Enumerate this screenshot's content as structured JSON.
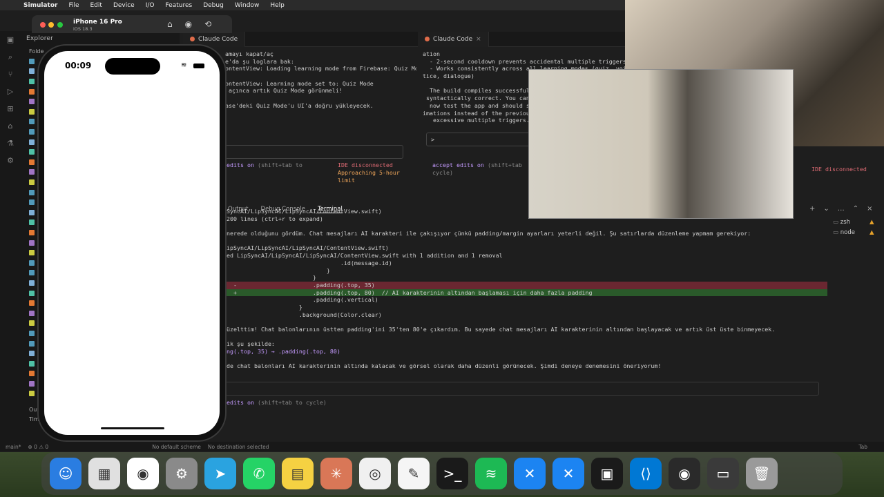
{
  "menubar": {
    "app": "Simulator",
    "items": [
      "File",
      "Edit",
      "Device",
      "I/O",
      "Features",
      "Debug",
      "Window",
      "Help"
    ]
  },
  "simulator": {
    "device": "iPhone 16 Pro",
    "os": "iOS 18.3",
    "time": "00:09"
  },
  "explorer": {
    "title": "Explorer",
    "folder_label": "Folde",
    "outline_label": "Out",
    "timeline_label": "Timel"
  },
  "editor_left": {
    "tab": "Claude Code",
    "lines": [
      "amayı kapat/aç",
      "e'da şu loglara bak:",
      "ontentView: Loading learning mode from Firebase: Quiz Mo",
      "",
      "ontentView: Learning mode set to: Quiz Mode",
      " açınca artık Quiz Mode görünmeli!",
      "",
      "ase'deki Quiz Mode'u UI'a doğru yükleyecek."
    ],
    "edits_on": "edits on",
    "edits_hint": "(shift+tab to",
    "ide_status": "IDE disconnected",
    "limit_1": "Approaching 5-hour",
    "limit_2": "limit"
  },
  "editor_right": {
    "tab": "Claude Code",
    "lines": [
      "ation",
      "  - 2-second cooldown prevents accidental multiple triggers",
      "  - Works consistently across all learning modes (quiz, voice",
      "tice, dialogue)",
      "",
      "  The build compiles successful",
      " syntactically correct. You can",
      "  now test the app and should se",
      "imations instead of the previou",
      "   excessive multiple triggers."
    ],
    "prompt": ">",
    "accept_edits": "accept edits on",
    "accept_hint_1": "(shift+tab",
    "accept_hint_2": "cycle)",
    "ide_status": "IDE disconnected"
  },
  "panel": {
    "tabs": [
      "Output",
      "Debug Console",
      "Terminal"
    ],
    "active": "Terminal",
    "terminals": [
      "zsh",
      "node"
    ]
  },
  "terminal": {
    "lines": [
      {
        "t": "SyncAI/LipSyncAI/LipSyncAI/ContentView.swift)",
        "c": ""
      },
      {
        "t": "200 lines (ctrl+r to expand)",
        "c": ""
      },
      {
        "t": "",
        "c": ""
      },
      {
        "t": "nerede olduğunu gördüm. Chat mesajları AI karakteri ile çakışıyor çünkü padding/margin ayarları yeterli değil. Şu satırlarda düzenleme yapmam gerekiyor:",
        "c": ""
      },
      {
        "t": "",
        "c": ""
      },
      {
        "t": "ipSyncAI/LipSyncAI/LipSyncAI/ContentView.swift)",
        "c": ""
      },
      {
        "t": "ed LipSyncAI/LipSyncAI/LipSyncAI/ContentView.swift with 1 addition and 1 removal",
        "c": ""
      },
      {
        "t": "                                 .id(message.id)",
        "c": ""
      },
      {
        "t": "                             }",
        "c": ""
      },
      {
        "t": "                         }",
        "c": ""
      },
      {
        "t": "  -                      .padding(.top, 35)",
        "c": "del"
      },
      {
        "t": "  +                      .padding(.top, 80)  // AI karakterinin altından başlaması için daha fazla padding",
        "c": "add"
      },
      {
        "t": "                         .padding(.vertical)",
        "c": ""
      },
      {
        "t": "                     }",
        "c": ""
      },
      {
        "t": "                     .background(Color.clear)",
        "c": ""
      },
      {
        "t": "",
        "c": ""
      },
      {
        "t": "üzelttim! Chat balonlarının üstten padding'ini 35'ten 80'e çıkardım. Bu sayede chat mesajları AI karakterinin altından başlayacak ve artık üst üste binmeyecek.",
        "c": ""
      },
      {
        "t": "",
        "c": ""
      },
      {
        "t": "ik şu şekilde:",
        "c": ""
      },
      {
        "t": "ng(.top, 35) → .padding(.top, 80)",
        "c": "purple"
      },
      {
        "t": "",
        "c": ""
      },
      {
        "t": "de chat balonları AI karakterinin altında kalacak ve görsel olarak daha düzenli görünecek. Şimdi deneye denemesini öneriyorum!",
        "c": ""
      }
    ],
    "edits_on": "edits on",
    "edits_hint": "(shift+tab to cycle)"
  },
  "statusbar": {
    "branch": "main*",
    "no_scheme": "No default scheme",
    "no_dest": "No destination selected",
    "tab_label": "Tab"
  },
  "dock": {
    "apps": [
      "finder-icon",
      "launchpad-icon",
      "chrome-icon",
      "settings-icon",
      "telegram-icon",
      "whatsapp-icon",
      "notes-icon",
      "claude-icon",
      "chatgpt-icon",
      "textedit-icon",
      "terminal-icon",
      "spotify-icon",
      "xcode-icon",
      "xcode-beta-icon",
      "vscode-like-icon",
      "vscode-icon",
      "obs-icon",
      "screenshot-icon",
      "trash-icon"
    ]
  },
  "colors": {
    "accent_orange": "#e06c4a",
    "diff_del": "#6b2731",
    "diff_add": "#2a5a2a"
  }
}
